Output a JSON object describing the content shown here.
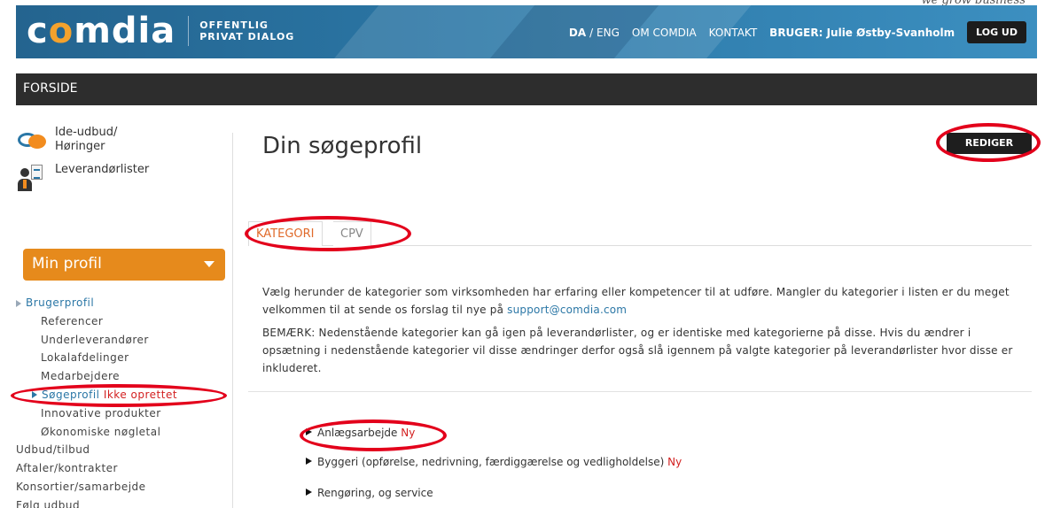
{
  "tagline": "we grow business",
  "header": {
    "logo_word": "comdia",
    "logo_sub_1": "OFFENTLIG",
    "logo_sub_2": "PRIVAT DIALOG",
    "lang_da": "DA",
    "lang_sep": "/ ENG",
    "om": "OM COMDIA",
    "kontakt": "KONTAKT",
    "bruger": "BRUGER: Julie Østby-Svanholm",
    "logout": "LOG UD"
  },
  "breadcrumb": "FORSIDE",
  "sidebar": {
    "links": [
      {
        "label": "Ide-udbud/\nHøringer"
      },
      {
        "label": "Leverandørlister"
      }
    ],
    "min_profil": "Min profil",
    "menu": [
      "Brugerprofil",
      "Referencer",
      "Underleverandører",
      "Lokalafdelinger",
      "Medarbejdere",
      "Søgeprofil",
      "Ikke oprettet",
      "Innovative produkter",
      "Økonomiske nøgletal",
      "Udbud/tilbud",
      "Aftaler/kontrakter",
      "Konsortier/samarbejde",
      "Følg udbud"
    ]
  },
  "main": {
    "title": "Din søgeprofil",
    "rediger": "REDIGER",
    "tabs": [
      "KATEGORI",
      "CPV"
    ],
    "intro_1": "Vælg herunder de kategorier som virksomheden har erfaring eller kompetencer til at udføre. Mangler du kategorier i listen er du meget velkommen til at sende os forslag til nye på ",
    "intro_link": "support@comdia.com",
    "intro_2": "BEMÆRK: Nedenstående kategorier kan gå igen på leverandørlister, og er identiske med kategorierne på disse. Hvis du ændrer i opsætning i nedenstående kategorier vil disse ændringer derfor også slå igennem på valgte kategorier på leverandørlister hvor disse er inkluderet.",
    "categories": [
      {
        "label": "Anlægsarbejde",
        "badge": "Ny"
      },
      {
        "label": "Byggeri (opførelse, nedrivning, færdiggærelse og vedligholdelse)",
        "badge": "Ny"
      },
      {
        "label": "Rengøring, og service",
        "badge": ""
      }
    ]
  },
  "colors": {
    "header_blue": "#2b77a6",
    "accent_orange": "#e68a1c",
    "annotation_red": "#e3001b",
    "badge_red": "#d32020"
  }
}
